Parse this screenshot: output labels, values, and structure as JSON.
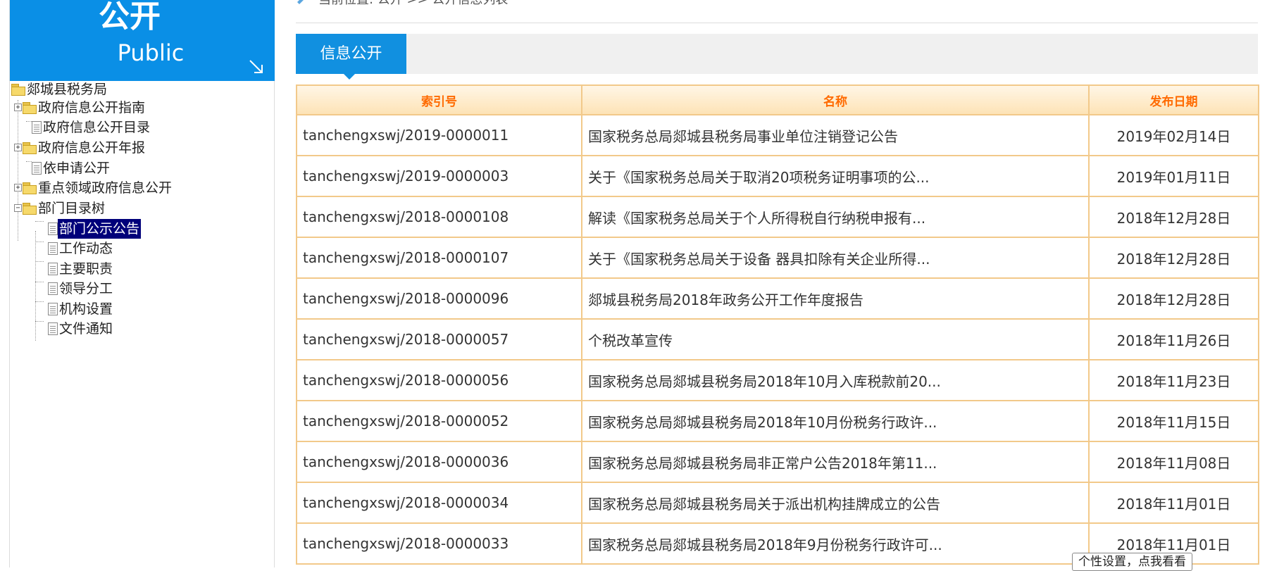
{
  "banner": {
    "title_cn": "公开",
    "title_en": "Public"
  },
  "breadcrumb": {
    "text": "当前位置: 公开 >> 公开信息列表"
  },
  "tab": {
    "label": "信息公开"
  },
  "tree": {
    "root": "郯城县税务局",
    "items": [
      {
        "label": "政府信息公开指南"
      },
      {
        "label": "政府信息公开目录"
      },
      {
        "label": "政府信息公开年报"
      },
      {
        "label": "依申请公开"
      },
      {
        "label": "重点领域政府信息公开"
      },
      {
        "label": "部门目录树"
      },
      {
        "label": "部门公示公告"
      },
      {
        "label": "工作动态"
      },
      {
        "label": "主要职责"
      },
      {
        "label": "领导分工"
      },
      {
        "label": "机构设置"
      },
      {
        "label": "文件通知"
      }
    ]
  },
  "table": {
    "headers": [
      "索引号",
      "名称",
      "发布日期"
    ],
    "rows": [
      [
        "tanchengxswj/2019-0000011",
        "国家税务总局郯城县税务局事业单位注销登记公告",
        "2019年02月14日"
      ],
      [
        "tanchengxswj/2019-0000003",
        "关于《国家税务总局关于取消20项税务证明事项的公...",
        "2019年01月11日"
      ],
      [
        "tanchengxswj/2018-0000108",
        "解读《国家税务总局关于个人所得税自行纳税申报有...",
        "2018年12月28日"
      ],
      [
        "tanchengxswj/2018-0000107",
        "关于《国家税务总局关于设备 器具扣除有关企业所得...",
        "2018年12月28日"
      ],
      [
        "tanchengxswj/2018-0000096",
        "郯城县税务局2018年政务公开工作年度报告",
        "2018年12月28日"
      ],
      [
        "tanchengxswj/2018-0000057",
        "个税改革宣传",
        "2018年11月26日"
      ],
      [
        "tanchengxswj/2018-0000056",
        "国家税务总局郯城县税务局2018年10月入库税款前20...",
        "2018年11月23日"
      ],
      [
        "tanchengxswj/2018-0000052",
        "国家税务总局郯城县税务局2018年10月份税务行政许...",
        "2018年11月15日"
      ],
      [
        "tanchengxswj/2018-0000036",
        "国家税务总局郯城县税务局非正常户公告2018年第11...",
        "2018年11月08日"
      ],
      [
        "tanchengxswj/2018-0000034",
        "国家税务总局郯城县税务局关于派出机构挂牌成立的公告",
        "2018年11月01日"
      ],
      [
        "tanchengxswj/2018-0000033",
        "国家税务总局郯城县税务局2018年9月份税务行政许可...",
        "2018年11月01日"
      ]
    ]
  },
  "tooltip": {
    "text": "个性设置，点我看看"
  }
}
